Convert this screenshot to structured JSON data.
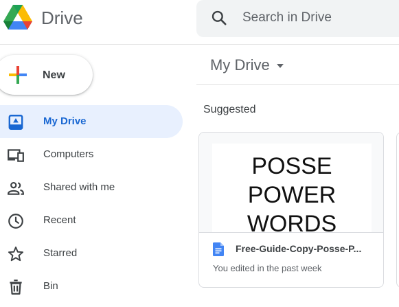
{
  "header": {
    "brand": "Drive",
    "search_placeholder": "Search in Drive"
  },
  "new_button": {
    "label": "New"
  },
  "sidebar": {
    "items": [
      {
        "label": "My Drive",
        "icon": "my-drive-icon",
        "active": true
      },
      {
        "label": "Computers",
        "icon": "computers-icon",
        "active": false
      },
      {
        "label": "Shared with me",
        "icon": "shared-icon",
        "active": false
      },
      {
        "label": "Recent",
        "icon": "clock-icon",
        "active": false
      },
      {
        "label": "Starred",
        "icon": "star-icon",
        "active": false
      },
      {
        "label": "Bin",
        "icon": "trash-icon",
        "active": false
      }
    ]
  },
  "main": {
    "title": "My Drive",
    "section": "Suggested",
    "suggested": [
      {
        "preview_lines": [
          "POSSE",
          "POWER",
          "WORDS"
        ],
        "name": "Free-Guide-Copy-Posse-P...",
        "meta": "You edited in the past week",
        "icon": "google-docs-icon"
      }
    ]
  },
  "colors": {
    "accent": "#1967d2",
    "active_bg": "#e8f0fe",
    "search_bg": "#f1f3f4",
    "docs_blue": "#4285f4"
  }
}
